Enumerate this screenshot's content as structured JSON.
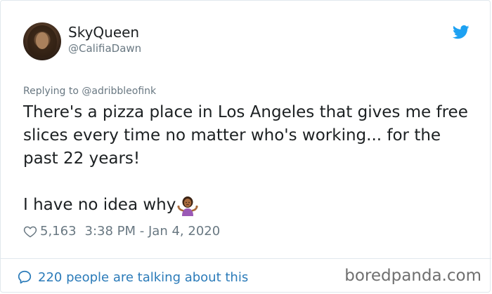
{
  "tweet": {
    "display_name": "SkyQueen",
    "handle": "@CalifiaDawn",
    "replying_to": "Replying to @adribbleofink",
    "text_paragraph_1": "There's a pizza place in Los Angeles that gives me free slices every time no matter who's working... for the past 22 years!",
    "text_paragraph_2": "I have no idea why",
    "emoji": "woman-shrugging",
    "likes": "5,163",
    "timestamp": "3:38 PM - Jan 4, 2020"
  },
  "footer": {
    "talking": "220 people are talking about this",
    "watermark": "boredpanda.com"
  },
  "colors": {
    "link_blue": "#2b7bb9",
    "twitter_blue": "#1da1f2",
    "muted_gray": "#697882",
    "text": "#1c2022",
    "border": "#e1e8ed"
  }
}
